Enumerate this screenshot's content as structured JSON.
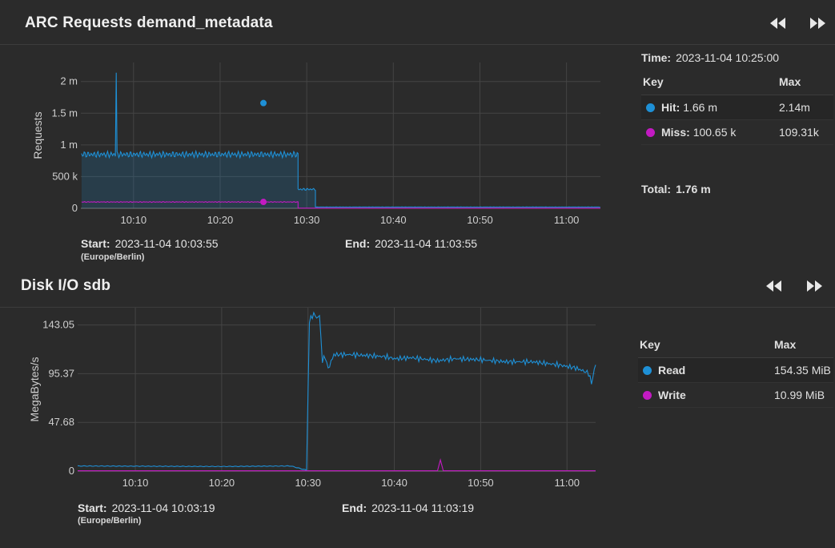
{
  "cards": [
    {
      "title": "ARC Requests demand_metadata",
      "legend": {
        "time_label": "Time:",
        "time_value": "2023-11-04 10:25:00",
        "key_header": "Key",
        "max_header": "Max",
        "rows": [
          {
            "name": "Hit:",
            "value": "1.66 m",
            "max": "2.14m",
            "color": "#1e90d6"
          },
          {
            "name": "Miss:",
            "value": "100.65 k",
            "max": "109.31k",
            "color": "#c21ac2"
          }
        ],
        "total_label": "Total:",
        "total_value": "1.76 m"
      },
      "start_label": "Start:",
      "start_value": "2023-11-04 10:03:55",
      "timezone": "(Europe/Berlin)",
      "end_label": "End:",
      "end_value": "2023-11-04 11:03:55"
    },
    {
      "title": "Disk I/O sdb",
      "legend": {
        "key_header": "Key",
        "max_header": "Max",
        "rows": [
          {
            "name": "Read",
            "value": "",
            "max": "154.35 MiB",
            "color": "#1e90d6"
          },
          {
            "name": "Write",
            "value": "",
            "max": "10.99 MiB",
            "color": "#c21ac2"
          }
        ]
      },
      "start_label": "Start:",
      "start_value": "2023-11-04 10:03:19",
      "timezone": "(Europe/Berlin)",
      "end_label": "End:",
      "end_value": "2023-11-04 11:03:19"
    }
  ],
  "chart_data": [
    {
      "type": "line",
      "ylabel": "Requests",
      "ylim": [
        0,
        2300000
      ],
      "yticks": [
        {
          "v": 0,
          "label": "0"
        },
        {
          "v": 500000,
          "label": "500 k"
        },
        {
          "v": 1000000,
          "label": "1 m"
        },
        {
          "v": 1500000,
          "label": "1.5 m"
        },
        {
          "v": 2000000,
          "label": "2 m"
        }
      ],
      "xlim": [
        "10:03:55",
        "11:03:55"
      ],
      "xticks": [
        "10:10",
        "10:20",
        "10:30",
        "10:40",
        "10:50",
        "11:00"
      ],
      "grid": true,
      "highlight_time": "10:25",
      "series": [
        {
          "name": "Hit",
          "color": "#1e90d6",
          "fill": true,
          "segments": [
            {
              "from": "10:04",
              "to": "10:29",
              "baseline": 850000,
              "peak": 1750000,
              "period_min": 0.5,
              "max": 2140000,
              "max_at": "10:08"
            },
            {
              "from": "10:29",
              "to": "10:31",
              "baseline": 300000,
              "peak": 800000,
              "period_min": 0.5
            },
            {
              "from": "10:31",
              "to": "11:03:55",
              "baseline": 20000,
              "peak": 930000,
              "period_min": 0.5
            }
          ],
          "highlight_value": 1660000
        },
        {
          "name": "Miss",
          "color": "#c21ac2",
          "fill": false,
          "segments": [
            {
              "from": "10:04",
              "to": "10:29",
              "baseline": 100000,
              "peak": 109310,
              "period_min": 0.5
            },
            {
              "from": "10:29",
              "to": "11:03:55",
              "baseline": 3000,
              "peak": 8000,
              "period_min": 0.5
            }
          ],
          "highlight_value": 100650
        }
      ]
    },
    {
      "type": "line",
      "ylabel": "MegaBytes/s",
      "ylim": [
        0,
        160
      ],
      "yticks": [
        {
          "v": 0,
          "label": "0"
        },
        {
          "v": 47.68,
          "label": "47.68"
        },
        {
          "v": 95.37,
          "label": "95.37"
        },
        {
          "v": 143.05,
          "label": "143.05"
        }
      ],
      "xlim": [
        "10:03:19",
        "11:03:19"
      ],
      "xticks": [
        "10:10",
        "10:20",
        "10:30",
        "10:40",
        "10:50",
        "11:00"
      ],
      "grid": true,
      "series": [
        {
          "name": "Read",
          "color": "#1e90d6",
          "points": [
            [
              "10:03:19",
              5
            ],
            [
              "10:20:00",
              4.5
            ],
            [
              "10:28:00",
              5
            ],
            [
              "10:29:20",
              2
            ],
            [
              "10:29:50",
              1
            ],
            [
              "10:30:10",
              147
            ],
            [
              "10:30:40",
              154
            ],
            [
              "10:31:00",
              150
            ],
            [
              "10:31:20",
              152
            ],
            [
              "10:31:40",
              108
            ],
            [
              "10:32:00",
              112
            ],
            [
              "10:32:20",
              100
            ],
            [
              "10:33:00",
              114
            ],
            [
              "10:35:00",
              114
            ],
            [
              "10:37:00",
              113
            ],
            [
              "10:39:00",
              112
            ],
            [
              "10:40:00",
              110
            ],
            [
              "10:42:00",
              111
            ],
            [
              "10:45:00",
              108
            ],
            [
              "10:47:00",
              110
            ],
            [
              "10:50:00",
              109
            ],
            [
              "10:53:00",
              107
            ],
            [
              "10:56:00",
              107
            ],
            [
              "10:59:00",
              104
            ],
            [
              "11:01:00",
              101
            ],
            [
              "11:02:30",
              96
            ],
            [
              "11:02:50",
              86
            ],
            [
              "11:03:19",
              104
            ]
          ]
        },
        {
          "name": "Write",
          "color": "#c21ac2",
          "points": [
            [
              "10:03:19",
              0.3
            ],
            [
              "10:45:00",
              0.3
            ],
            [
              "10:45:20",
              10.99
            ],
            [
              "10:45:40",
              0.3
            ],
            [
              "11:03:19",
              0.3
            ]
          ]
        }
      ]
    }
  ]
}
